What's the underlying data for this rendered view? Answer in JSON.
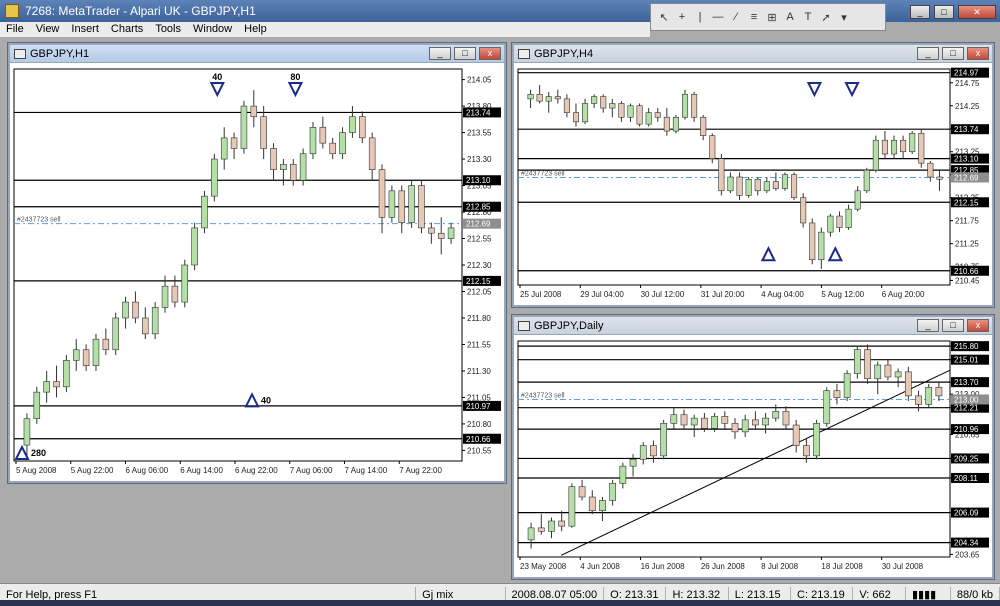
{
  "app": {
    "title": "7268: MetaTrader - Alpari UK - GBPJPY,H1"
  },
  "menu": [
    "File",
    "View",
    "Insert",
    "Charts",
    "Tools",
    "Window",
    "Help"
  ],
  "toolbar_icons": [
    "cursor-icon",
    "crosshair-icon",
    "vertical-line-icon",
    "horizontal-line-icon",
    "trendline-icon",
    "channel-icon",
    "fibonacci-icon",
    "text-icon",
    "label-icon",
    "arrow-icon",
    "more-icon"
  ],
  "windows": {
    "h1": {
      "title": "GBPJPY,H1",
      "buttons": {
        "min": "_",
        "max": "□",
        "close": "x"
      }
    },
    "h4": {
      "title": "GBPJPY,H4",
      "buttons": {
        "min": "_",
        "max": "□",
        "close": "x"
      }
    },
    "daily": {
      "title": "GBPJPY,Daily",
      "buttons": {
        "min": "_",
        "max": "□",
        "close": "x"
      }
    }
  },
  "chart_data": [
    {
      "type": "candlestick",
      "symbol": "GBPJPY,H1",
      "ylim": [
        210.45,
        214.15
      ],
      "y_ticks": [
        "214.05",
        "213.80",
        "213.55",
        "213.30",
        "213.05",
        "212.80",
        "212.55",
        "212.30",
        "212.05",
        "211.80",
        "211.55",
        "211.30",
        "211.05",
        "210.80",
        "210.55"
      ],
      "x_ticks": [
        "5 Aug 2008",
        "5 Aug 22:00",
        "6 Aug 06:00",
        "6 Aug 14:00",
        "6 Aug 22:00",
        "7 Aug 06:00",
        "7 Aug 14:00",
        "7 Aug 22:00"
      ],
      "levels": [
        {
          "value": 213.74,
          "label": "213.74"
        },
        {
          "value": 213.1,
          "label": "213.10"
        },
        {
          "value": 212.85,
          "label": "212.85"
        },
        {
          "value": 212.15,
          "label": "212.15"
        },
        {
          "value": 210.97,
          "label": "210.97"
        },
        {
          "value": 210.66,
          "label": "210.66"
        }
      ],
      "order_line": {
        "value": 212.69,
        "label": "212.69",
        "text": "#2437723 sell"
      },
      "markers": [
        {
          "dir": "down",
          "x": 0.45,
          "text": "40"
        },
        {
          "dir": "up",
          "x": 0.53,
          "text": "40"
        },
        {
          "dir": "down",
          "x": 0.63,
          "text": "80"
        },
        {
          "dir": "up",
          "x": 0.0,
          "text": "280"
        }
      ],
      "candles": [
        [
          210.6,
          210.9,
          210.5,
          210.85
        ],
        [
          210.85,
          211.15,
          210.8,
          211.1
        ],
        [
          211.1,
          211.3,
          211.0,
          211.2
        ],
        [
          211.2,
          211.35,
          211.05,
          211.15
        ],
        [
          211.15,
          211.45,
          211.1,
          211.4
        ],
        [
          211.4,
          211.6,
          211.3,
          211.5
        ],
        [
          211.5,
          211.55,
          211.3,
          211.35
        ],
        [
          211.35,
          211.65,
          211.3,
          211.6
        ],
        [
          211.6,
          211.7,
          211.45,
          211.5
        ],
        [
          211.5,
          211.85,
          211.45,
          211.8
        ],
        [
          211.8,
          212.0,
          211.7,
          211.95
        ],
        [
          211.95,
          212.05,
          211.75,
          211.8
        ],
        [
          211.8,
          211.9,
          211.6,
          211.65
        ],
        [
          211.65,
          211.95,
          211.6,
          211.9
        ],
        [
          211.9,
          212.2,
          211.85,
          212.1
        ],
        [
          212.1,
          212.2,
          211.9,
          211.95
        ],
        [
          211.95,
          212.35,
          211.9,
          212.3
        ],
        [
          212.3,
          212.7,
          212.25,
          212.65
        ],
        [
          212.65,
          213.0,
          212.6,
          212.95
        ],
        [
          212.95,
          213.35,
          212.9,
          213.3
        ],
        [
          213.3,
          213.6,
          213.2,
          213.5
        ],
        [
          213.5,
          213.55,
          213.3,
          213.4
        ],
        [
          213.4,
          213.85,
          213.35,
          213.8
        ],
        [
          213.8,
          213.95,
          213.6,
          213.7
        ],
        [
          213.7,
          213.8,
          213.3,
          213.4
        ],
        [
          213.4,
          213.45,
          213.1,
          213.2
        ],
        [
          213.2,
          213.3,
          213.05,
          213.25
        ],
        [
          213.25,
          213.3,
          213.05,
          213.1
        ],
        [
          213.1,
          213.4,
          213.05,
          213.35
        ],
        [
          213.35,
          213.65,
          213.3,
          213.6
        ],
        [
          213.6,
          213.7,
          213.4,
          213.45
        ],
        [
          213.45,
          213.5,
          213.3,
          213.35
        ],
        [
          213.35,
          213.6,
          213.3,
          213.55
        ],
        [
          213.55,
          213.8,
          213.5,
          213.7
        ],
        [
          213.7,
          213.75,
          213.45,
          213.5
        ],
        [
          213.5,
          213.55,
          213.1,
          213.2
        ],
        [
          213.2,
          213.25,
          212.6,
          212.75
        ],
        [
          212.75,
          213.05,
          212.7,
          213.0
        ],
        [
          213.0,
          213.05,
          212.6,
          212.7
        ],
        [
          212.7,
          213.1,
          212.65,
          213.05
        ],
        [
          213.05,
          213.1,
          212.6,
          212.65
        ],
        [
          212.65,
          212.7,
          212.5,
          212.6
        ],
        [
          212.6,
          212.75,
          212.4,
          212.55
        ],
        [
          212.55,
          212.7,
          212.5,
          212.65
        ]
      ]
    },
    {
      "type": "candlestick",
      "symbol": "GBPJPY,H4",
      "ylim": [
        210.35,
        215.05
      ],
      "y_ticks": [
        "214.75",
        "214.25",
        "213.75",
        "213.25",
        "212.75",
        "212.25",
        "211.75",
        "211.25",
        "210.75",
        "210.45"
      ],
      "x_ticks": [
        "25 Jul 2008",
        "29 Jul 04:00",
        "30 Jul 12:00",
        "31 Jul 20:00",
        "4 Aug 04:00",
        "5 Aug 12:00",
        "6 Aug 20:00"
      ],
      "levels": [
        {
          "value": 214.97,
          "label": "214.97"
        },
        {
          "value": 213.74,
          "label": "213.74"
        },
        {
          "value": 213.1,
          "label": "213.10"
        },
        {
          "value": 212.85,
          "label": "212.85"
        },
        {
          "value": 212.15,
          "label": "212.15"
        },
        {
          "value": 210.66,
          "label": "210.66"
        }
      ],
      "order_line": {
        "value": 212.69,
        "label": "212.69",
        "text": "#2437723 sell"
      },
      "markers": [
        {
          "dir": "down",
          "x": 0.69,
          "text": ""
        },
        {
          "dir": "up",
          "x": 0.74,
          "text": ""
        },
        {
          "dir": "down",
          "x": 0.78,
          "text": ""
        },
        {
          "dir": "up",
          "x": 0.58,
          "text": ""
        }
      ],
      "candles": [
        [
          214.4,
          214.6,
          214.2,
          214.5
        ],
        [
          214.5,
          214.7,
          214.3,
          214.35
        ],
        [
          214.35,
          214.55,
          214.1,
          214.45
        ],
        [
          214.45,
          214.6,
          214.3,
          214.4
        ],
        [
          214.4,
          214.5,
          214.0,
          214.1
        ],
        [
          214.1,
          214.3,
          213.8,
          213.9
        ],
        [
          213.9,
          214.4,
          213.85,
          214.3
        ],
        [
          214.3,
          214.5,
          214.2,
          214.45
        ],
        [
          214.45,
          214.5,
          214.1,
          214.2
        ],
        [
          214.2,
          214.4,
          214.0,
          214.3
        ],
        [
          214.3,
          214.35,
          213.9,
          214.0
        ],
        [
          214.0,
          214.3,
          213.9,
          214.25
        ],
        [
          214.25,
          214.3,
          213.8,
          213.85
        ],
        [
          213.85,
          214.2,
          213.8,
          214.1
        ],
        [
          214.1,
          214.2,
          213.9,
          214.0
        ],
        [
          214.0,
          214.2,
          213.6,
          213.7
        ],
        [
          213.7,
          214.05,
          213.65,
          214.0
        ],
        [
          214.0,
          214.6,
          213.95,
          214.5
        ],
        [
          214.5,
          214.55,
          213.9,
          214.0
        ],
        [
          214.0,
          214.05,
          213.5,
          213.6
        ],
        [
          213.6,
          213.65,
          213.0,
          213.1
        ],
        [
          213.1,
          213.2,
          212.3,
          212.4
        ],
        [
          212.4,
          212.8,
          212.35,
          212.7
        ],
        [
          212.7,
          212.8,
          212.2,
          212.3
        ],
        [
          212.3,
          212.7,
          212.25,
          212.65
        ],
        [
          212.65,
          212.7,
          212.3,
          212.4
        ],
        [
          212.4,
          212.7,
          212.35,
          212.6
        ],
        [
          212.6,
          212.8,
          212.4,
          212.45
        ],
        [
          212.45,
          212.8,
          212.4,
          212.75
        ],
        [
          212.75,
          212.8,
          212.2,
          212.25
        ],
        [
          212.25,
          212.35,
          211.6,
          211.7
        ],
        [
          211.7,
          211.8,
          210.8,
          210.9
        ],
        [
          210.9,
          211.6,
          210.7,
          211.5
        ],
        [
          211.5,
          211.9,
          211.4,
          211.85
        ],
        [
          211.85,
          211.95,
          211.5,
          211.6
        ],
        [
          211.6,
          212.1,
          211.55,
          212.0
        ],
        [
          212.0,
          212.5,
          211.95,
          212.4
        ],
        [
          212.4,
          212.9,
          212.35,
          212.85
        ],
        [
          212.85,
          213.6,
          212.8,
          213.5
        ],
        [
          213.5,
          213.7,
          213.1,
          213.2
        ],
        [
          213.2,
          213.6,
          213.1,
          213.5
        ],
        [
          213.5,
          213.6,
          213.1,
          213.25
        ],
        [
          213.25,
          213.7,
          213.2,
          213.65
        ],
        [
          213.65,
          213.75,
          212.9,
          213.0
        ],
        [
          213.0,
          213.05,
          212.6,
          212.7
        ],
        [
          212.7,
          212.85,
          212.4,
          212.65
        ]
      ]
    },
    {
      "type": "candlestick",
      "symbol": "GBPJPY,Daily",
      "ylim": [
        203.5,
        216.1
      ],
      "y_ticks": [
        "215.80",
        "215.01",
        "213.70",
        "213.00",
        "212.21",
        "210.96",
        "210.65",
        "209.25",
        "208.11",
        "206.09",
        "204.34",
        "203.65"
      ],
      "x_ticks": [
        "23 May 2008",
        "4 Jun 2008",
        "16 Jun 2008",
        "26 Jun 2008",
        "8 Jul 2008",
        "18 Jul 2008",
        "30 Jul 2008"
      ],
      "levels": [
        {
          "value": 215.8,
          "label": "215.80"
        },
        {
          "value": 215.01,
          "label": "215.01"
        },
        {
          "value": 213.7,
          "label": "213.70"
        },
        {
          "value": 212.21,
          "label": "212.21"
        },
        {
          "value": 210.96,
          "label": "210.96"
        },
        {
          "value": 209.25,
          "label": "209.25"
        },
        {
          "value": 208.11,
          "label": "208.11"
        },
        {
          "value": 206.09,
          "label": "206.09"
        },
        {
          "value": 204.34,
          "label": "204.34"
        }
      ],
      "order_line": {
        "value": 212.69,
        "label": "213.00",
        "text": "#2437723 sell"
      },
      "trendline": {
        "from": [
          0.1,
          203.6
        ],
        "to": [
          1.0,
          214.4
        ]
      },
      "candles": [
        [
          204.5,
          205.5,
          204.0,
          205.2
        ],
        [
          205.2,
          206.0,
          204.8,
          205.0
        ],
        [
          205.0,
          205.8,
          204.6,
          205.6
        ],
        [
          205.6,
          206.2,
          205.0,
          205.3
        ],
        [
          205.3,
          207.8,
          205.2,
          207.6
        ],
        [
          207.6,
          208.0,
          206.8,
          207.0
        ],
        [
          207.0,
          207.4,
          206.0,
          206.2
        ],
        [
          206.2,
          207.0,
          205.6,
          206.8
        ],
        [
          206.8,
          208.0,
          206.5,
          207.8
        ],
        [
          207.8,
          209.0,
          207.5,
          208.8
        ],
        [
          208.8,
          209.5,
          208.2,
          209.2
        ],
        [
          209.2,
          210.2,
          208.9,
          210.0
        ],
        [
          210.0,
          210.3,
          209.0,
          209.4
        ],
        [
          209.4,
          211.5,
          209.2,
          211.3
        ],
        [
          211.3,
          212.2,
          211.0,
          211.8
        ],
        [
          211.8,
          212.1,
          211.0,
          211.2
        ],
        [
          211.2,
          211.8,
          210.5,
          211.6
        ],
        [
          211.6,
          211.9,
          210.8,
          211.0
        ],
        [
          211.0,
          211.9,
          210.8,
          211.7
        ],
        [
          211.7,
          212.0,
          211.0,
          211.3
        ],
        [
          211.3,
          211.6,
          210.4,
          210.8
        ],
        [
          210.8,
          211.8,
          210.5,
          211.5
        ],
        [
          211.5,
          212.0,
          211.0,
          211.2
        ],
        [
          211.2,
          211.9,
          210.7,
          211.6
        ],
        [
          211.6,
          212.4,
          211.4,
          212.0
        ],
        [
          212.0,
          212.3,
          211.0,
          211.2
        ],
        [
          211.2,
          211.5,
          209.6,
          210.0
        ],
        [
          210.0,
          210.4,
          209.0,
          209.4
        ],
        [
          209.4,
          211.5,
          209.2,
          211.3
        ],
        [
          211.3,
          213.4,
          211.1,
          213.2
        ],
        [
          213.2,
          213.6,
          212.4,
          212.8
        ],
        [
          212.8,
          214.4,
          212.6,
          214.2
        ],
        [
          214.2,
          215.8,
          213.9,
          215.6
        ],
        [
          215.6,
          215.9,
          213.6,
          213.9
        ],
        [
          213.9,
          214.9,
          213.0,
          214.7
        ],
        [
          214.7,
          215.0,
          213.8,
          214.0
        ],
        [
          214.0,
          214.5,
          213.4,
          214.3
        ],
        [
          214.3,
          214.6,
          212.6,
          212.9
        ],
        [
          212.9,
          213.2,
          212.0,
          212.4
        ],
        [
          212.4,
          213.6,
          212.2,
          213.4
        ],
        [
          213.4,
          213.7,
          212.6,
          212.9
        ]
      ]
    }
  ],
  "status": {
    "help": "For Help, press F1",
    "profile": "Gj mix",
    "time": "2008.08.07 05:00",
    "open": "O: 213.31",
    "high": "H: 213.32",
    "low": "L: 213.15",
    "close": "C: 213.19",
    "volume": "V: 662",
    "traffic": "88/0 kb"
  },
  "colors": {
    "bull": "#b4e0a8",
    "bear": "#e6c8b4",
    "marker": "#1c2a8c",
    "order": "#5ea0d8"
  }
}
